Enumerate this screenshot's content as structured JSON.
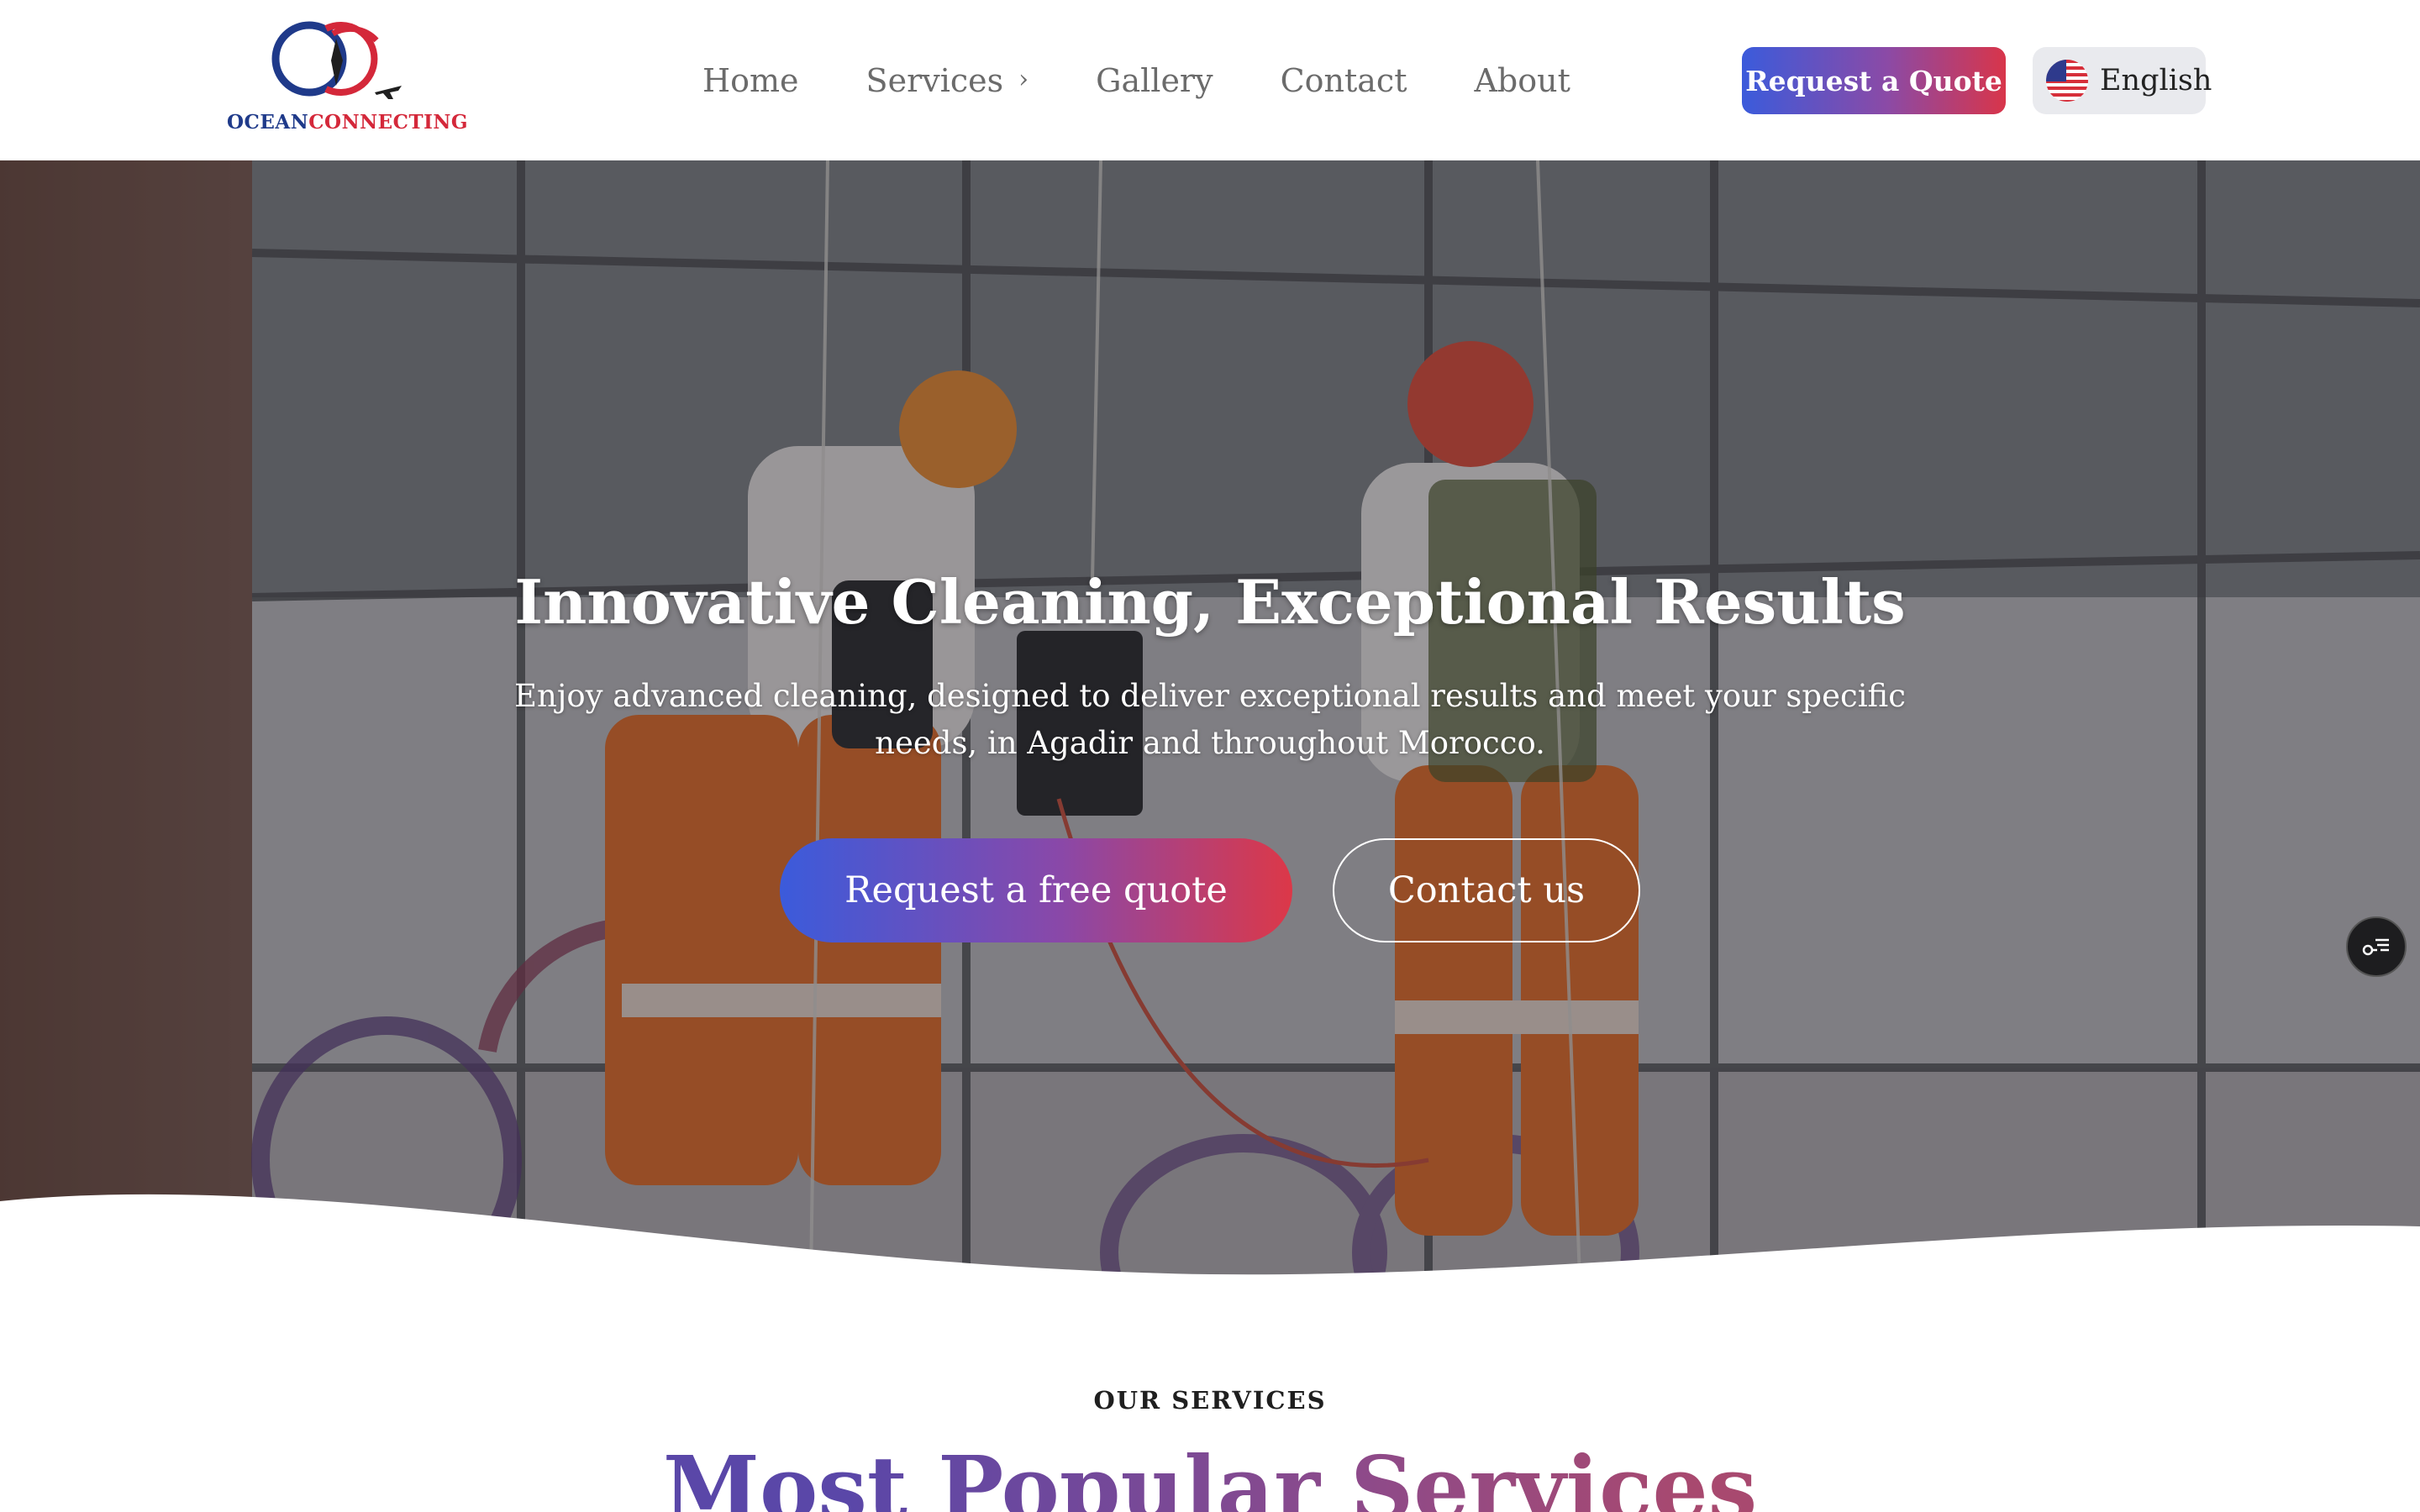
{
  "brand": {
    "logo_part1": "OCEAN",
    "logo_part2": "CONNECTING",
    "colors": {
      "navy": "#1f3a8a",
      "red": "#d4283a"
    }
  },
  "nav": {
    "items": [
      {
        "label": "Home"
      },
      {
        "label": "Services",
        "has_chevron": true
      },
      {
        "label": "Gallery"
      },
      {
        "label": "Contact"
      },
      {
        "label": "About"
      }
    ]
  },
  "header": {
    "quote_button": "Request a Quote",
    "language": {
      "label": "English",
      "flag_icon": "us-flag-icon"
    }
  },
  "hero": {
    "title": "Innovative Cleaning, Exceptional Results",
    "subtitle": "Enjoy advanced cleaning, designed to deliver exceptional results and meet your specific needs, in Agadir and throughout Morocco.",
    "primary_cta": "Request a free quote",
    "secondary_cta": "Contact us",
    "side_widget_icon": "key-menu-icon"
  },
  "services": {
    "eyebrow": "OUR SERVICES",
    "title": "Most Popular Services"
  },
  "theme": {
    "gradient_start": "#3b5bdb",
    "gradient_mid": "#8b4aa6",
    "gradient_end": "#d8354a"
  }
}
